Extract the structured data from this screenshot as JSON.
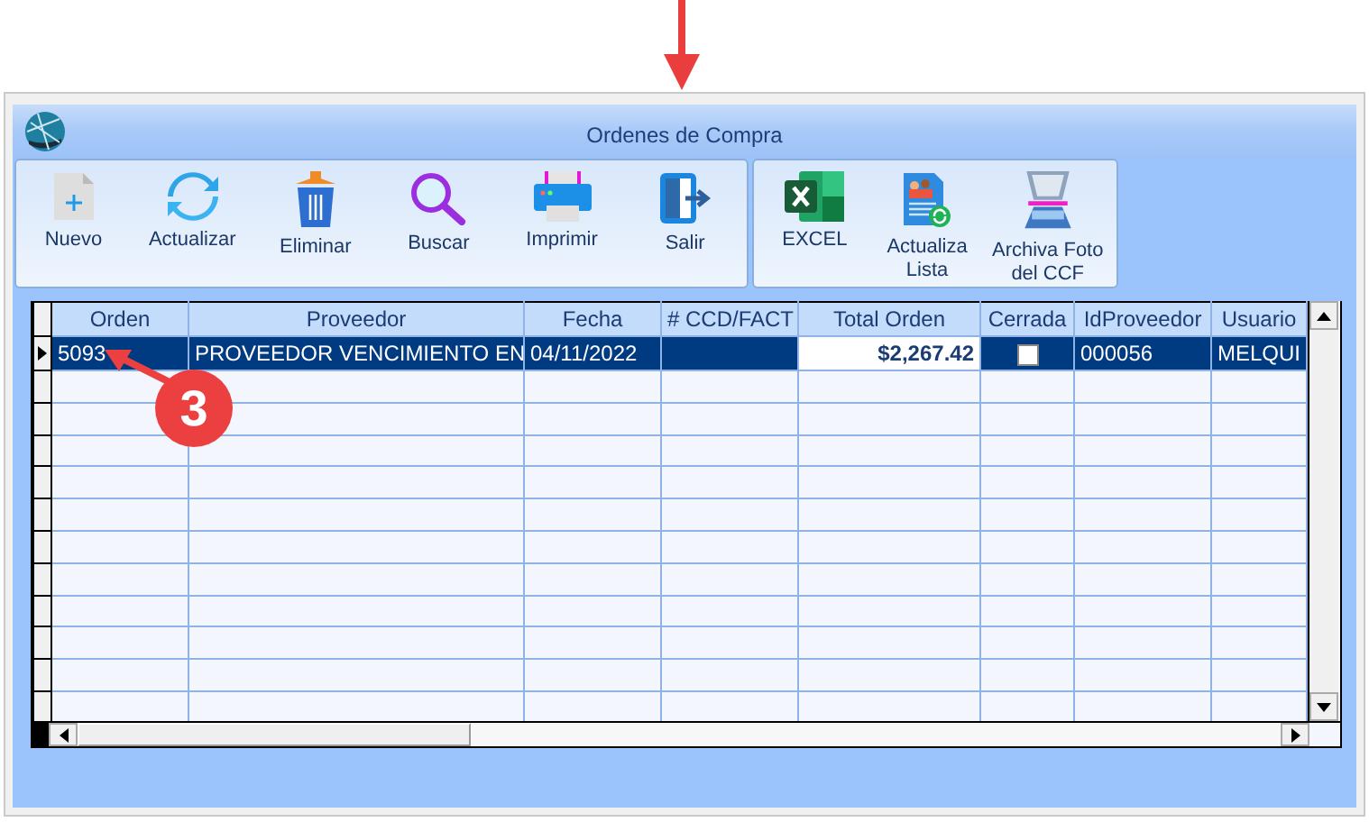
{
  "window": {
    "title": "Ordenes de Compra"
  },
  "toolbar": [
    {
      "label": "Nuevo",
      "kind": "new"
    },
    {
      "label": "Actualizar",
      "kind": "refresh"
    },
    {
      "label": "Eliminar",
      "kind": "delete"
    },
    {
      "label": "Buscar",
      "kind": "search"
    },
    {
      "label": "Imprimir",
      "kind": "print"
    },
    {
      "label": "Salir",
      "kind": "exit"
    }
  ],
  "toolbar_2": [
    {
      "label": "EXCEL",
      "kind": "excel"
    },
    {
      "label": "Actualiza Lista",
      "kind": "list"
    },
    {
      "label": "Archiva Foto del CCF",
      "kind": "scanner"
    }
  ],
  "table": {
    "columns": [
      "Orden",
      "Proveedor",
      "Fecha",
      "# CCD/FACT",
      "Total Orden",
      "Cerrada",
      "IdProveedor",
      "Usuario"
    ],
    "rows": [
      {
        "selected": true,
        "orden": "5093",
        "proveedor": "PROVEEDOR VENCIMIENTO EN",
        "fecha": "04/11/2022",
        "ccd_fact": "",
        "total": "$2,267.42",
        "cerrada": false,
        "id_proveedor": "000056",
        "usuario": "MELQUI"
      }
    ]
  },
  "annotation": {
    "label": "3"
  }
}
